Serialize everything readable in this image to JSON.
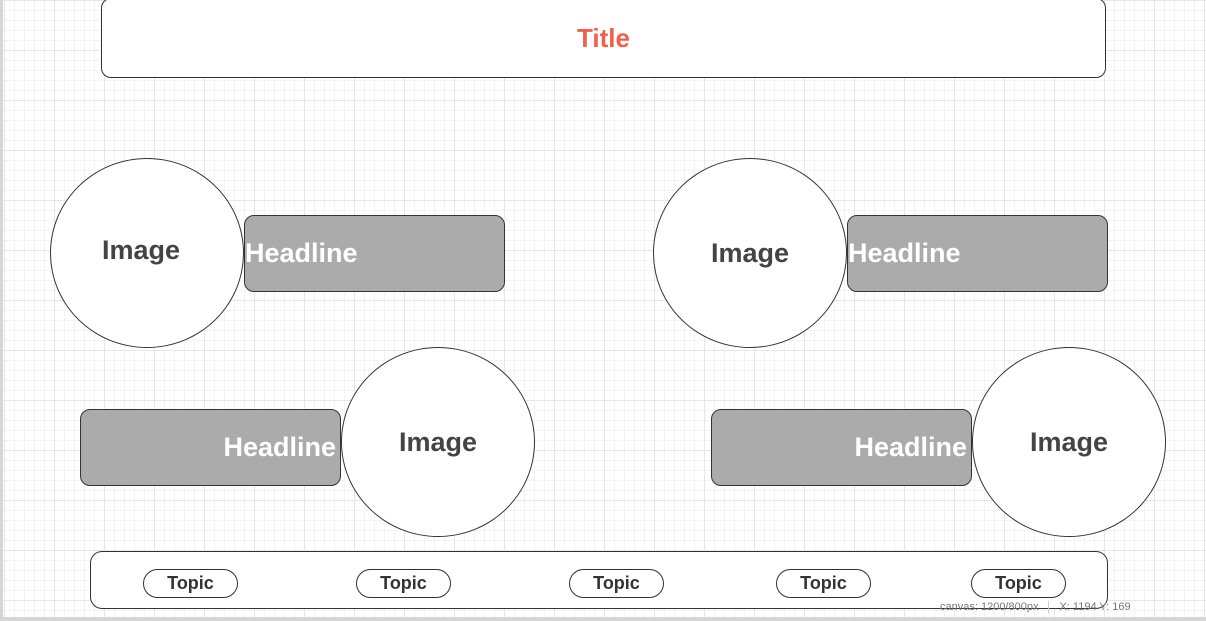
{
  "title": "Title",
  "image_label": "Image",
  "headline_label": "Headline",
  "topics": [
    "Topic",
    "Topic",
    "Topic",
    "Topic",
    "Topic"
  ],
  "status": {
    "canvas": "canvas: 1200/800px",
    "coords": "X: 1194 Y: 169"
  },
  "colors": {
    "title": "#f0604a",
    "headline_fill": "#ababab",
    "headline_text": "#ffffff",
    "image_text": "#444444"
  }
}
